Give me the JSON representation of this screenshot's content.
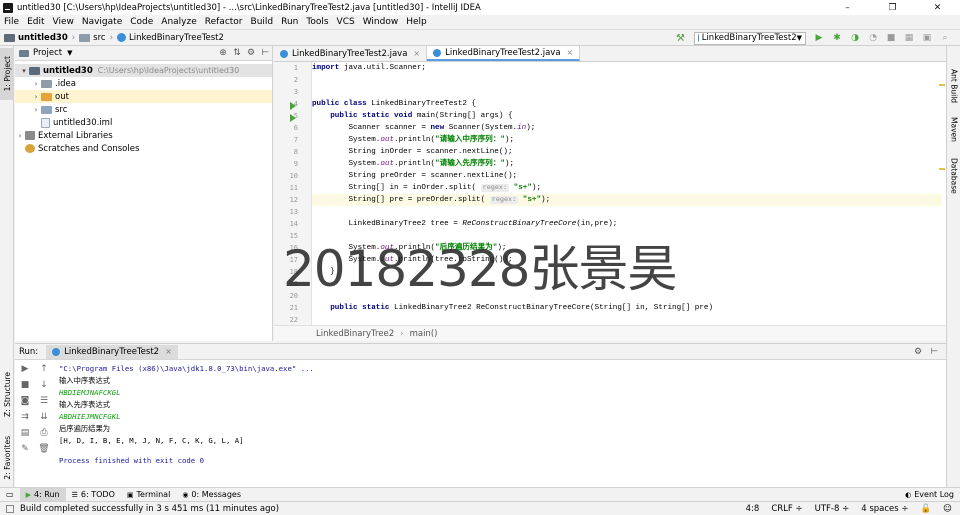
{
  "window": {
    "title": "untitled30 [C:\\Users\\hp\\IdeaProjects\\untitled30] - ...\\src\\LinkedBinaryTreeTest2.java [untitled30] - IntelliJ IDEA",
    "minimize": "–",
    "maximize": "❐",
    "close": "✕"
  },
  "menu": [
    "File",
    "Edit",
    "View",
    "Navigate",
    "Code",
    "Analyze",
    "Refactor",
    "Build",
    "Run",
    "Tools",
    "VCS",
    "Window",
    "Help"
  ],
  "nav": {
    "crumbs": [
      "untitled30",
      "src",
      "LinkedBinaryTreeTest2"
    ],
    "run_config": "LinkedBinaryTreeTest2"
  },
  "left_stripe": {
    "project": "1: Project",
    "structure": "Z: Structure",
    "favorites": "2: Favorites"
  },
  "right_stripe": {
    "ant": "Ant Build",
    "maven": "Maven",
    "database": "Database"
  },
  "project": {
    "header": "Project",
    "tree": [
      {
        "label": "untitled30",
        "path": "C:\\Users\\hp\\IdeaProjects\\untitled30"
      },
      {
        "label": ".idea"
      },
      {
        "label": "out"
      },
      {
        "label": "src"
      },
      {
        "label": "untitled30.iml"
      },
      {
        "label": "External Libraries"
      },
      {
        "label": "Scratches and Consoles"
      }
    ]
  },
  "editor": {
    "tabs": [
      "LinkedBinaryTreeTest2.java",
      "LinkedBinaryTreeTest2.java"
    ],
    "tab_close": "×",
    "line_numbers": [
      "1",
      "2",
      "3",
      "4",
      "5",
      "6",
      "7",
      "8",
      "9",
      "10",
      "11",
      "12",
      "13",
      "14",
      "15",
      "16",
      "17",
      "18",
      "19",
      "20",
      "21",
      "22"
    ],
    "hints": [
      "regex:",
      "regex:"
    ],
    "breadcrumb": [
      "LinkedBinaryTree2",
      "main()"
    ],
    "strings": {
      "s1": "\"请输入中序序列：\"",
      "s2": "\"请输入先序序列：\"",
      "s3": "\"s+\"",
      "s4": "\"s+\"",
      "s5": "\"后序遍历结果为\""
    }
  },
  "watermark": "20182328张景昊",
  "run": {
    "label": "Run:",
    "tab": "LinkedBinaryTreeTest2",
    "console": {
      "cmd": "\"C:\\Program Files (x86)\\Java\\jdk1.8.0_73\\bin\\java.exe\" ...",
      "l1": "输入中序表达式",
      "l2": "HBDIEMJNAFCKGL",
      "l3": "输入先序表达式",
      "l4": "ABDHIEJMNCFGKL",
      "l5": "后序遍历结果为",
      "l6": "[H, D, I, B, E, M, J, N, F, C, K, G, L, A]",
      "l7": "Process finished with exit code 0"
    }
  },
  "bottom_tabs": {
    "run": "4: Run",
    "todo": "6: TODO",
    "terminal": "Terminal",
    "messages": "0: Messages",
    "event_log": "Event Log"
  },
  "status": {
    "message": "Build completed successfully in 3 s 451 ms (11 minutes ago)",
    "position": "4:8",
    "line_sep": "CRLF ÷",
    "encoding": "UTF-8 ÷",
    "indent": "4 spaces ÷"
  }
}
